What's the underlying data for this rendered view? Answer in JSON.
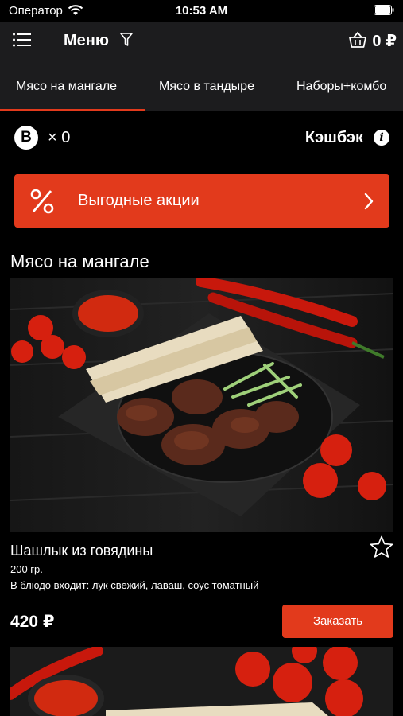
{
  "status_bar": {
    "carrier": "Оператор",
    "time": "10:53 AM"
  },
  "header": {
    "title": "Меню",
    "cart_total": "0 ₽",
    "icons": [
      "menu-list-icon",
      "filter-icon",
      "basket-icon"
    ]
  },
  "tabs": [
    {
      "label": "Мясо на мангале",
      "active": true
    },
    {
      "label": "Мясо в тандыре",
      "active": false
    },
    {
      "label": "Наборы+комбо",
      "active": false
    }
  ],
  "bonus": {
    "icon_letter": "B",
    "count": "× 0",
    "cashback_label": "Кэшбэк",
    "info_symbol": "i"
  },
  "promo": {
    "label": "Выгодные акции"
  },
  "section": {
    "title": "Мясо на мангале"
  },
  "products": [
    {
      "name": "Шашлык из говядины",
      "weight": "200 гр.",
      "description": "В блюдо входит: лук свежий, лаваш, соус томатный",
      "price": "420 ₽",
      "order_label": "Заказать"
    }
  ],
  "colors": {
    "accent": "#e23a1c",
    "header_bg": "#1c1c1e",
    "background": "#000000"
  }
}
